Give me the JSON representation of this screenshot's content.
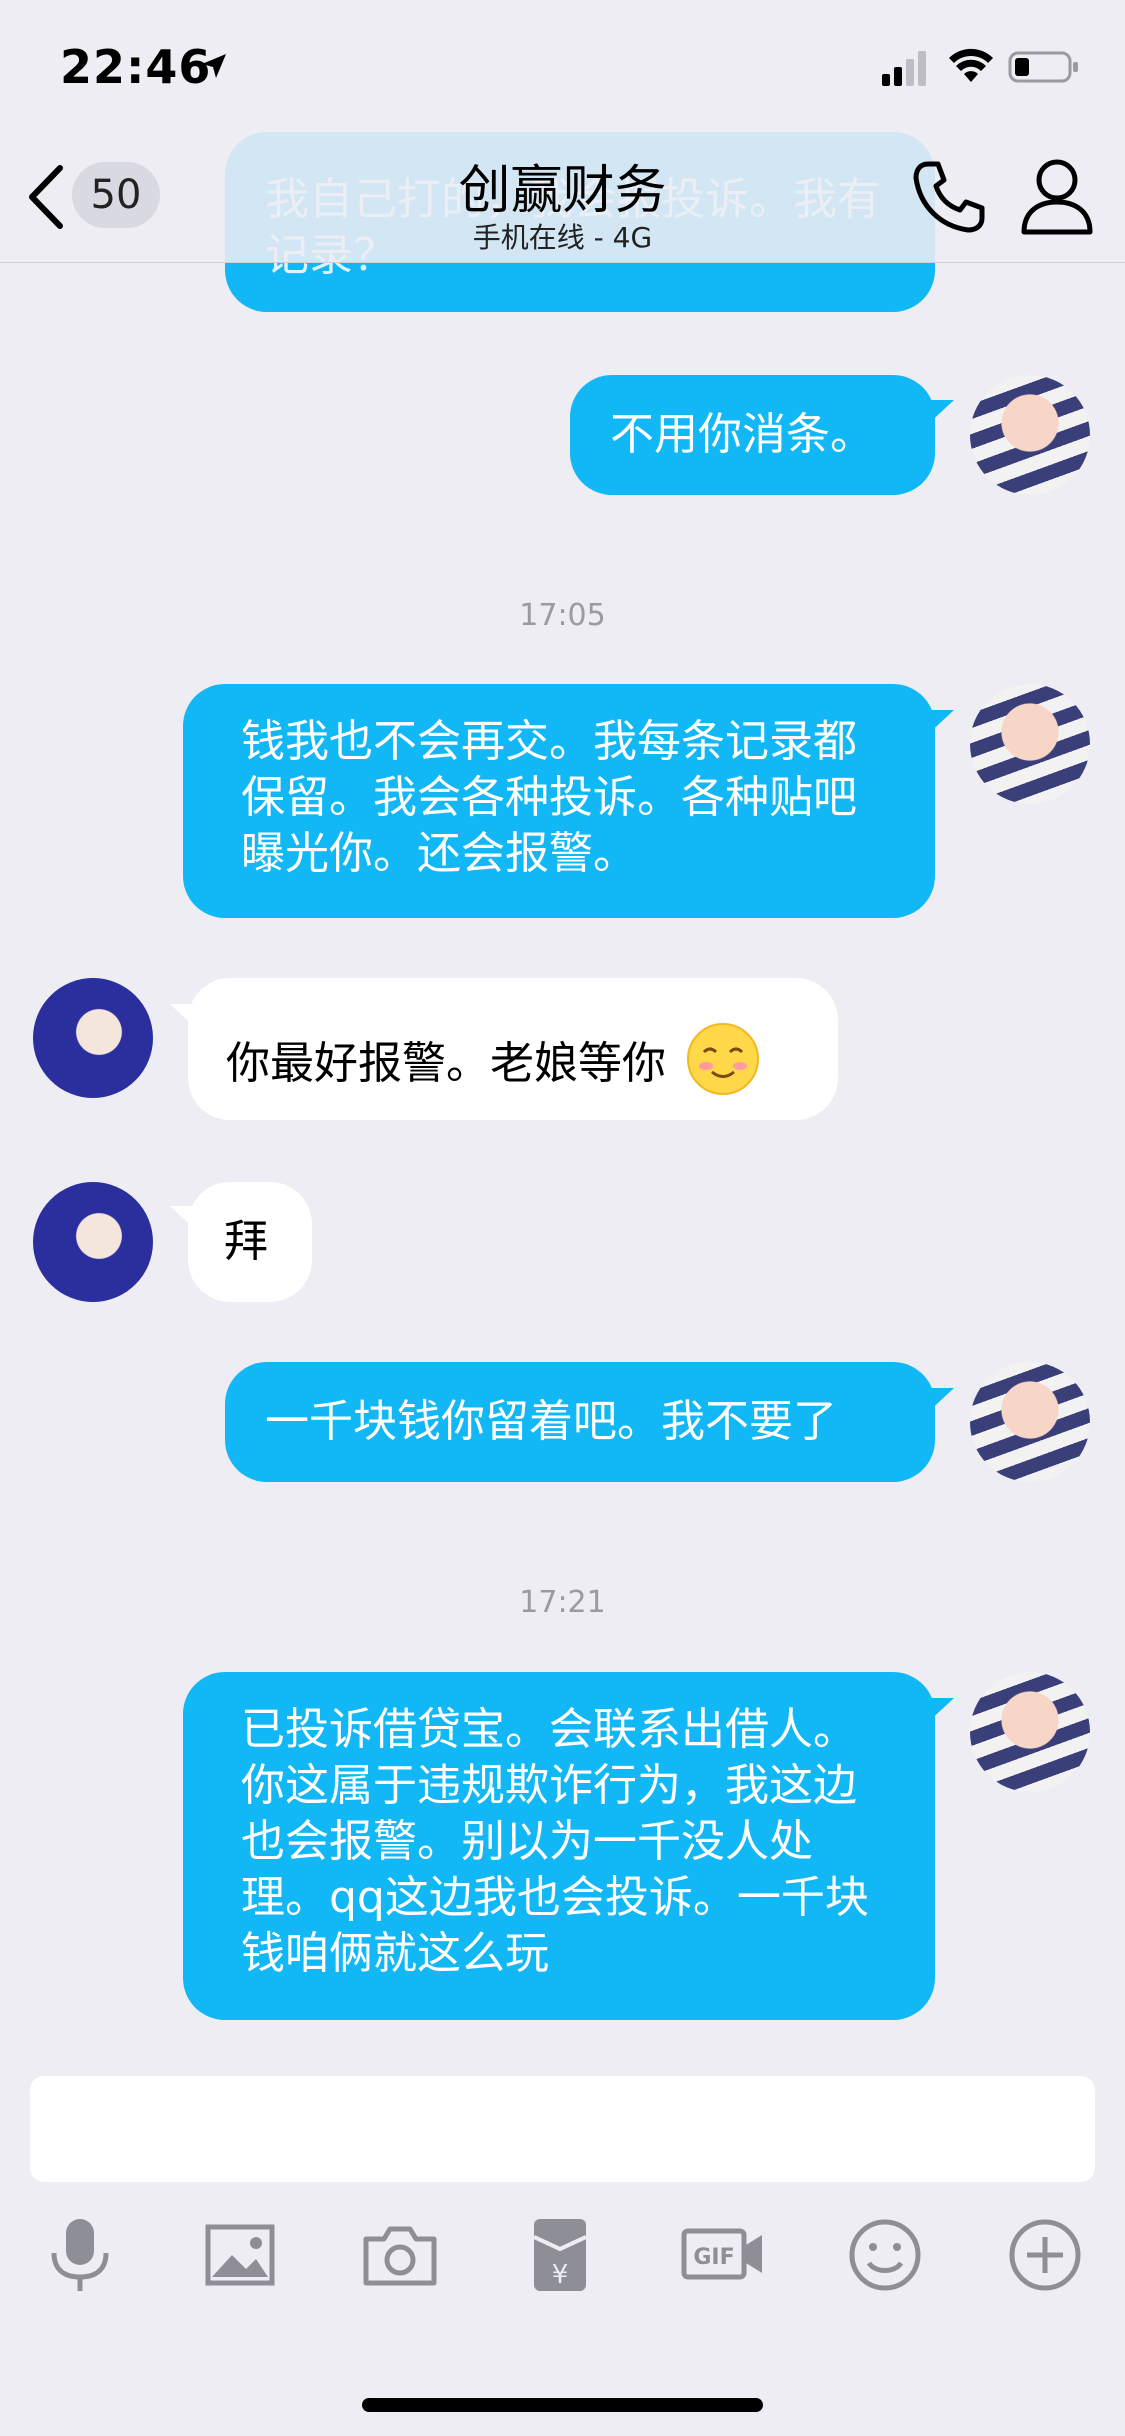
{
  "status": {
    "time": "22:46"
  },
  "header": {
    "back_count": "50",
    "title": "创赢财务",
    "subtitle": "手机在线 - 4G"
  },
  "messages": [
    {
      "side": "out",
      "text": "我自己打的，我会报投诉。我有记录？"
    },
    {
      "side": "out",
      "text": "不用你消条。"
    },
    {
      "side": "out",
      "text": "钱我也不会再交。我每条记录都保留。我会各种投诉。各种贴吧曝光你。还会报警。"
    },
    {
      "side": "in",
      "text": "你最好报警。老娘等你"
    },
    {
      "side": "in",
      "text": "拜"
    },
    {
      "side": "out",
      "text": "一千块钱你留着吧。我不要了"
    },
    {
      "side": "out",
      "text": "已投诉借贷宝。会联系出借人。你这属于违规欺诈行为，我这边也会报警。别以为一千没人处理。qq这边我也会投诉。一千块钱咱俩就这么玩"
    }
  ],
  "timestamps": [
    "17:05",
    "17:21"
  ],
  "input": {
    "value": ""
  },
  "toolbar": [
    "microphone-icon",
    "image-icon",
    "camera-icon",
    "red-packet-icon",
    "gif-icon",
    "emoji-icon",
    "plus-icon"
  ],
  "colors": {
    "bubble_out": "#12b7f5",
    "bubble_in": "#ffffff",
    "background": "#ededf3"
  }
}
